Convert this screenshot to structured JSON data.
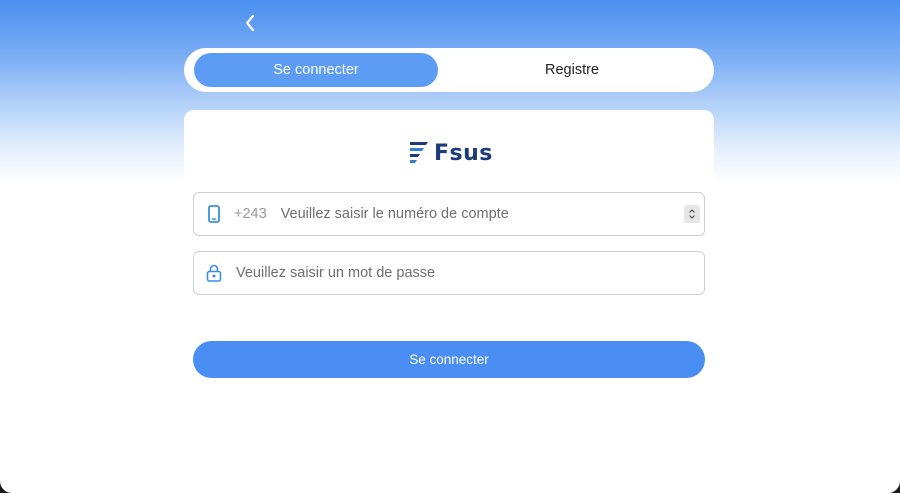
{
  "header": {
    "back_icon": "chevron-left-icon"
  },
  "tabs": [
    {
      "label": "Se connecter",
      "active": true
    },
    {
      "label": "Registre",
      "active": false
    }
  ],
  "brand": {
    "name": "Fsus",
    "logo_icon": "fsus-stripes-logo",
    "color": "#1b3b7a"
  },
  "form": {
    "phone": {
      "icon": "mobile-phone-icon",
      "prefix": "+243",
      "placeholder": "Veuillez saisir le numéro de compte",
      "value": ""
    },
    "password": {
      "icon": "lock-icon",
      "placeholder": "Veuillez saisir un mot de passe",
      "value": ""
    },
    "submit_label": "Se connecter"
  },
  "colors": {
    "accent": "#4a8df3",
    "tab_active": "#5d9cf5",
    "icon": "#3a8ee0"
  }
}
